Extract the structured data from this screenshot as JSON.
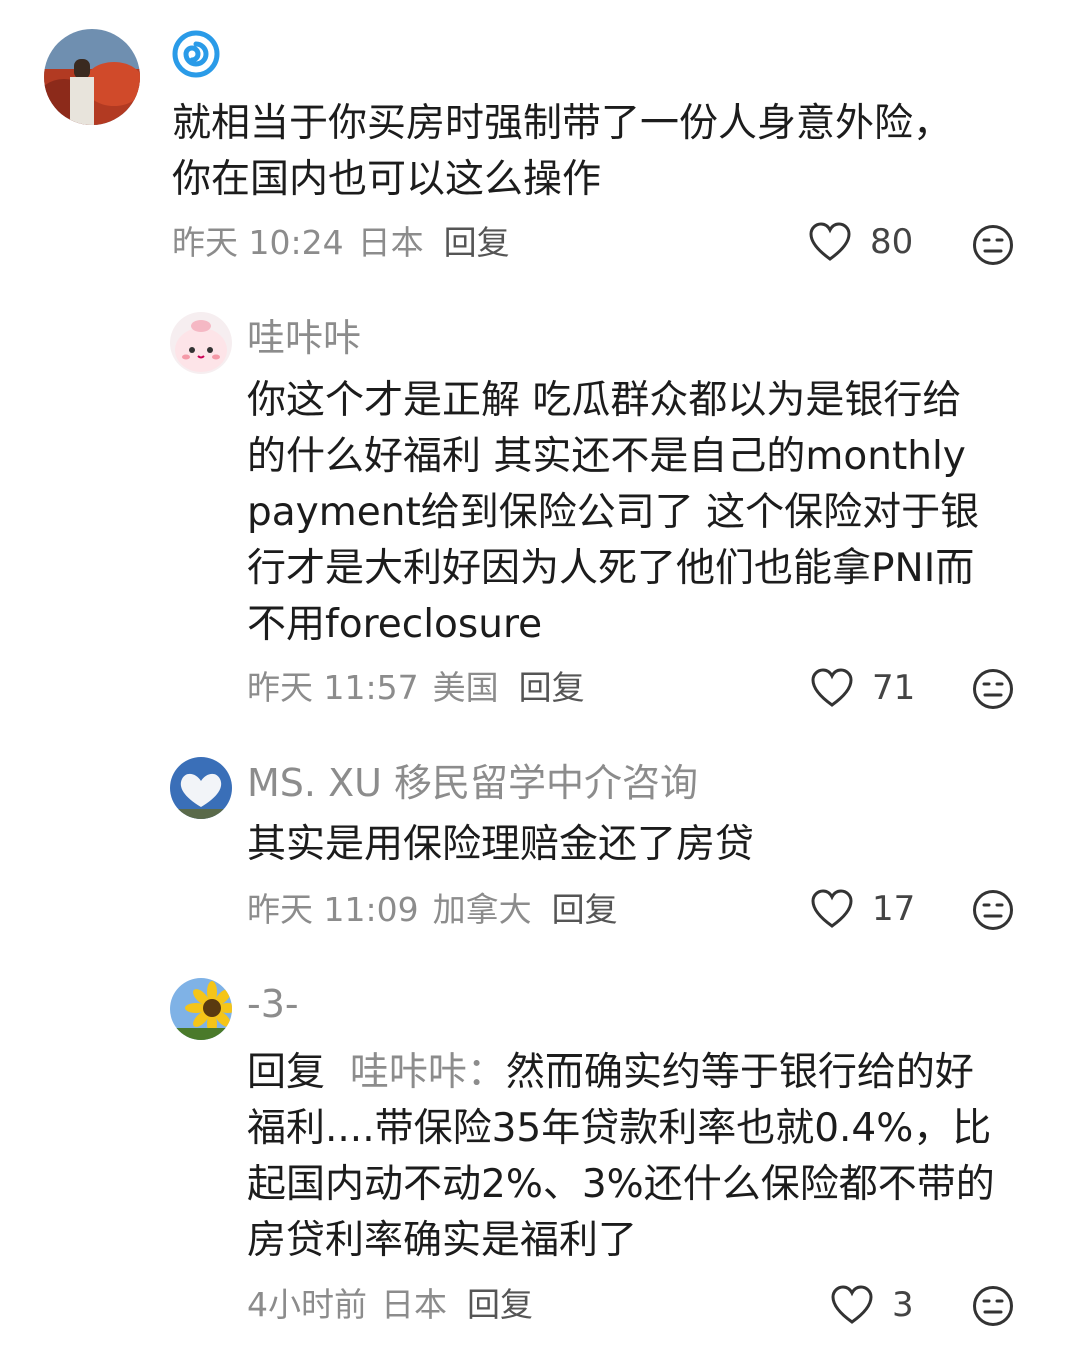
{
  "comments": [
    {
      "user_badge_icon": "swirl-badge-icon",
      "text_lines": [
        "就相当于你买房时强制带了一份人身意外险，",
        "你在国内也可以这么操作"
      ],
      "time": "昨天 10:24",
      "location": "日本",
      "reply_label": "回复",
      "likes": "80"
    },
    {
      "username": "哇咔咔",
      "text_lines": [
        "你这个才是正解 吃瓜群众都以为是银行给",
        "的什么好福利 其实还不是自己的monthly",
        "payment给到保险公司了 这个保险对于银",
        "行才是大利好因为人死了他们也能拿PNI而",
        "不用foreclosure"
      ],
      "time": "昨天 11:57",
      "location": "美国",
      "reply_label": "回复",
      "likes": "71"
    },
    {
      "username": "MS. XU 移民留学中介咨询",
      "text_lines": [
        "其实是用保险理赔金还了房贷"
      ],
      "time": "昨天 11:09",
      "location": "加拿大",
      "reply_label": "回复",
      "likes": "17"
    },
    {
      "username": "-3-",
      "reply_prefix": "回复",
      "reply_to": "哇咔咔：",
      "first_line_rest": "然而确实约等于银行给的好",
      "text_lines": [
        "福利....带保险35年贷款利率也就0.4%，比",
        "起国内动不动2%、3%还什么保险都不带的",
        "房贷利率确实是福利了"
      ],
      "time": "4小时前",
      "location": "日本",
      "reply_label": "回复",
      "likes": "3"
    }
  ],
  "colors": {
    "meta": "#8c8c8c",
    "text": "#1c1c1c",
    "badge": "#2a9be8"
  }
}
